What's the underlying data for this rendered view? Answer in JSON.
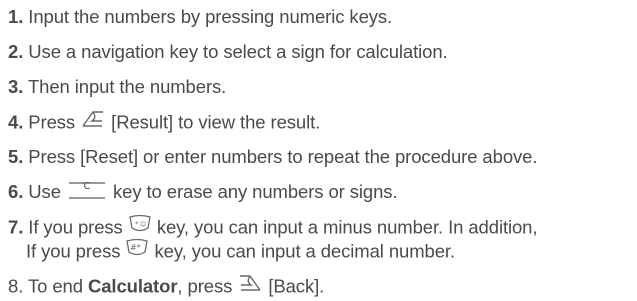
{
  "steps": [
    {
      "num": "1.",
      "text": "Input the numbers by pressing numeric keys."
    },
    {
      "num": "2.",
      "text": "Use a navigation key to select a sign for calculation."
    },
    {
      "num": "3.",
      "text": "Then input the numbers."
    },
    {
      "num": "4.",
      "before": "Press",
      "after": "[Result] to view the result."
    },
    {
      "num": "5.",
      "text": "Press [Reset] or enter numbers to repeat the procedure above."
    },
    {
      "num": "6.",
      "before": "Use",
      "key_label": "C",
      "after": "key to erase any numbers or signs."
    },
    {
      "num": "7.",
      "line1_before": "If you press",
      "line1_after": "key, you can input a minus number. In addition,",
      "line2_before": "If you press",
      "line2_after": "key, you can input a decimal number."
    },
    {
      "num": "8.",
      "before": "To end",
      "bold": "Calculator",
      "middle": ", press",
      "after": "[Back]."
    }
  ],
  "icons": {
    "step4": "left-soft-key-icon",
    "step6": "clear-key-icon",
    "step7a": "star-key-icon",
    "step7b": "hash-key-icon",
    "step8": "right-soft-key-icon"
  }
}
